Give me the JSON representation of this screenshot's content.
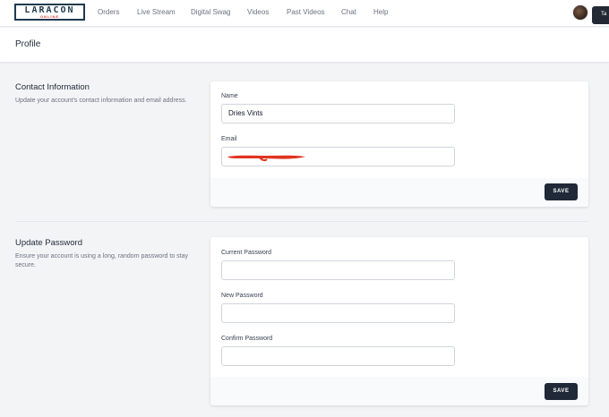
{
  "nav": {
    "logo": "LARACON",
    "logo_sub": "ONLINE",
    "items": [
      "Orders",
      "Live Stream",
      "Digital Swag",
      "Videos",
      "Past Videos",
      "Chat",
      "Help"
    ],
    "corner_tab": "Ta"
  },
  "page": {
    "title": "Profile"
  },
  "contact": {
    "title": "Contact Information",
    "description": "Update your account's contact information and email address.",
    "name_label": "Name",
    "name_value": "Dries Vints",
    "email_label": "Email",
    "email_value": "",
    "save_label": "SAVE"
  },
  "password": {
    "title": "Update Password",
    "description_line1": "Ensure your account is using a long, random password to stay",
    "description_line2": "secure.",
    "current_label": "Current Password",
    "new_label": "New Password",
    "confirm_label": "Confirm Password",
    "save_label": "SAVE"
  },
  "colors": {
    "primary_button": "#1f2937",
    "redaction": "#e0341f",
    "logo": "#1f3a4d"
  }
}
